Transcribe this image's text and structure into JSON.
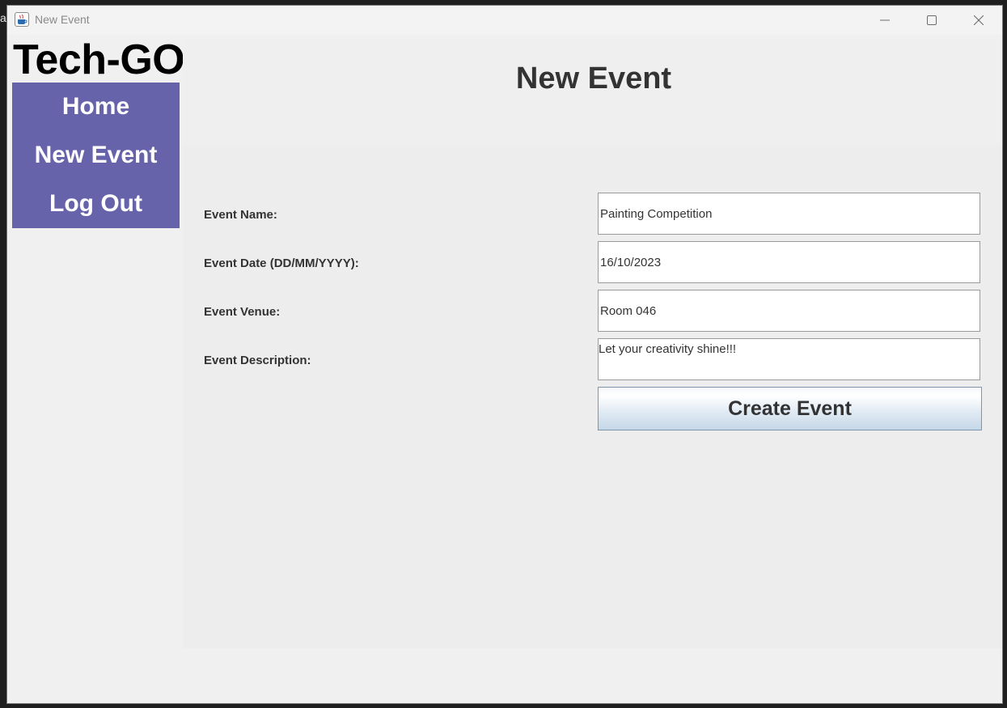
{
  "backdrop": {
    "sliver_text": "ag"
  },
  "window": {
    "title": "New Event",
    "icon": "java-cup-icon",
    "controls": {
      "minimize": "minimize-icon",
      "maximize": "maximize-icon",
      "close": "close-icon"
    }
  },
  "brand": {
    "name": "Tech-GO"
  },
  "nav": {
    "background": "#6763ab",
    "items": [
      {
        "label": "Home"
      },
      {
        "label": "New Event"
      },
      {
        "label": "Log Out"
      }
    ]
  },
  "main": {
    "title": "New Event",
    "form": {
      "event_name": {
        "label": "Event Name:",
        "value": "Painting Competition"
      },
      "event_date": {
        "label": "Event Date (DD/MM/YYYY):",
        "value": "16/10/2023"
      },
      "event_venue": {
        "label": "Event Venue:",
        "value": "Room 046"
      },
      "event_description": {
        "label": "Event Description:",
        "value": "Let your creativity shine!!!"
      }
    },
    "submit_label": "Create Event"
  }
}
